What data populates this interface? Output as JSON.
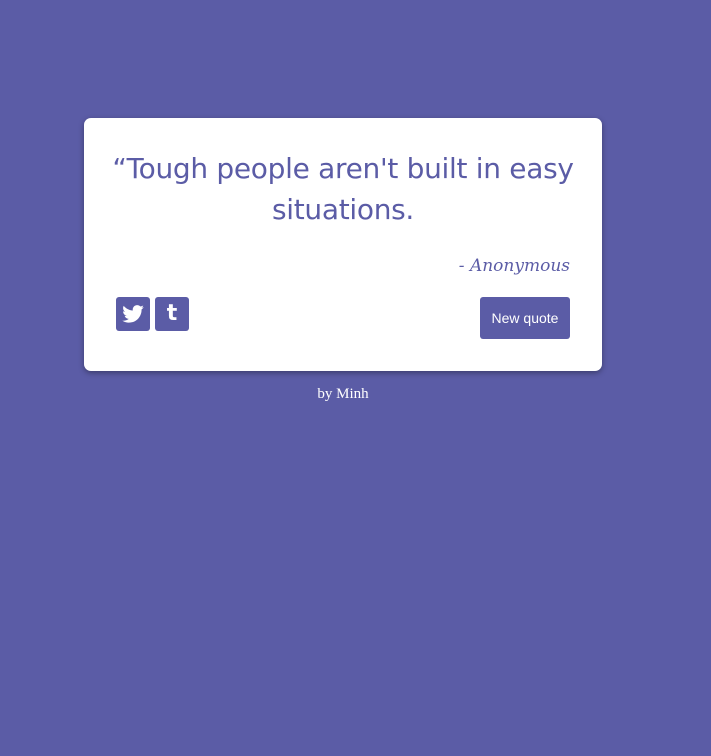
{
  "colors": {
    "background": "#5b5ca6",
    "card": "#ffffff",
    "accent": "#5b5ca6",
    "button_text": "#ffffff"
  },
  "quote": {
    "open_mark": "“",
    "text": "Tough people aren't built in easy situations.",
    "author": "- Anonymous"
  },
  "actions": {
    "twitter_icon": "twitter-icon",
    "tumblr_icon": "tumblr-icon",
    "tumblr_glyph": "t",
    "new_quote_label": "New quote"
  },
  "footer": {
    "credit": "by Minh"
  }
}
